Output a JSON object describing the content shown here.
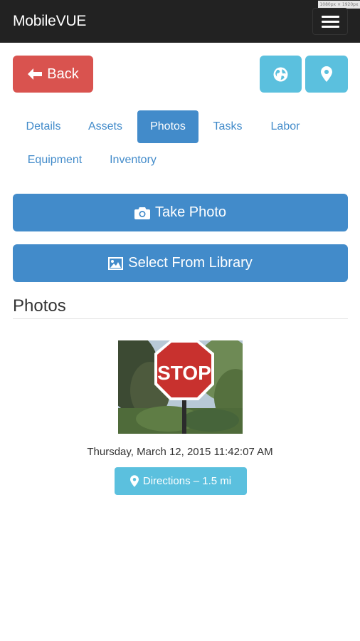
{
  "app": {
    "title": "MobileVUE",
    "resolution_tag": "1080px × 1920px"
  },
  "header": {
    "menu_icon": "hamburger-icon"
  },
  "toolbar": {
    "back_label": "Back",
    "back_icon": "arrow-left-icon",
    "globe_icon": "globe-icon",
    "marker_icon": "map-marker-icon"
  },
  "tabs": [
    {
      "label": "Details",
      "active": false
    },
    {
      "label": "Assets",
      "active": false
    },
    {
      "label": "Photos",
      "active": true
    },
    {
      "label": "Tasks",
      "active": false
    },
    {
      "label": "Labor",
      "active": false
    },
    {
      "label": "Equipment",
      "active": false
    },
    {
      "label": "Inventory",
      "active": false
    }
  ],
  "actions": {
    "take_photo_label": "Take Photo",
    "take_photo_icon": "camera-icon",
    "library_label": "Select From Library",
    "library_icon": "picture-icon"
  },
  "photos": {
    "heading": "Photos",
    "items": [
      {
        "sign_text": "STOP",
        "timestamp": "Thursday, March 12, 2015 11:42:07 AM",
        "directions_label": "Directions – 1.5 mi",
        "directions_icon": "map-marker-icon"
      }
    ]
  },
  "colors": {
    "navbar": "#222222",
    "danger": "#d9534f",
    "info": "#5bc0de",
    "primary": "#428bca"
  }
}
